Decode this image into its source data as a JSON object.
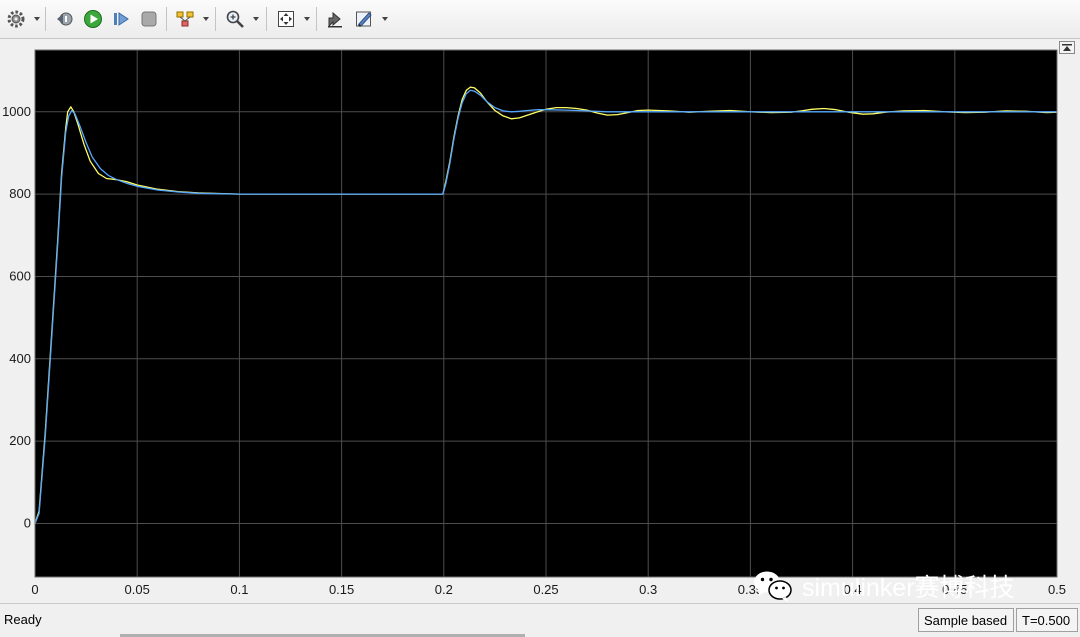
{
  "toolbar": {
    "icons": [
      "gear-icon",
      "step-back-icon",
      "run-icon",
      "step-forward-icon",
      "stop-icon",
      "signal-select-icon",
      "zoom-icon",
      "autoscale-icon",
      "highlight-icon",
      "style-icon"
    ]
  },
  "chart_data": {
    "type": "line",
    "xlim": [
      0,
      0.5
    ],
    "ylim": [
      -130,
      1150
    ],
    "x_ticks": [
      0,
      0.05,
      0.1,
      0.15,
      0.2,
      0.25,
      0.3,
      0.35,
      0.4,
      0.45,
      0.5
    ],
    "x_tick_labels": [
      "0",
      "0.05",
      "0.1",
      "0.15",
      "0.2",
      "0.25",
      "0.3",
      "0.35",
      "0.4",
      "0.45",
      "0.5"
    ],
    "y_ticks": [
      0,
      200,
      400,
      600,
      800,
      1000
    ],
    "y_tick_labels": [
      "0",
      "200",
      "400",
      "600",
      "800",
      "1000"
    ],
    "grid": true,
    "background": "#000000",
    "grid_color": "#4d4d4d",
    "series": [
      {
        "color": "#ffff66",
        "points": [
          [
            0,
            0
          ],
          [
            0.002,
            30
          ],
          [
            0.005,
            220
          ],
          [
            0.008,
            450
          ],
          [
            0.011,
            680
          ],
          [
            0.013,
            850
          ],
          [
            0.015,
            960
          ],
          [
            0.016,
            1000
          ],
          [
            0.0175,
            1012
          ],
          [
            0.019,
            1000
          ],
          [
            0.021,
            970
          ],
          [
            0.024,
            920
          ],
          [
            0.027,
            880
          ],
          [
            0.031,
            850
          ],
          [
            0.035,
            838
          ],
          [
            0.04,
            835
          ],
          [
            0.045,
            830
          ],
          [
            0.05,
            822
          ],
          [
            0.06,
            812
          ],
          [
            0.07,
            806
          ],
          [
            0.08,
            803
          ],
          [
            0.1,
            800
          ],
          [
            0.15,
            800
          ],
          [
            0.1995,
            800
          ],
          [
            0.201,
            830
          ],
          [
            0.203,
            880
          ],
          [
            0.205,
            940
          ],
          [
            0.207,
            990
          ],
          [
            0.209,
            1030
          ],
          [
            0.211,
            1052
          ],
          [
            0.213,
            1060
          ],
          [
            0.215,
            1058
          ],
          [
            0.218,
            1045
          ],
          [
            0.221,
            1025
          ],
          [
            0.225,
            1003
          ],
          [
            0.229,
            990
          ],
          [
            0.233,
            983
          ],
          [
            0.237,
            985
          ],
          [
            0.241,
            992
          ],
          [
            0.246,
            1000
          ],
          [
            0.25,
            1006
          ],
          [
            0.255,
            1010
          ],
          [
            0.26,
            1010
          ],
          [
            0.265,
            1008
          ],
          [
            0.27,
            1004
          ],
          [
            0.275,
            997
          ],
          [
            0.28,
            992
          ],
          [
            0.285,
            993
          ],
          [
            0.29,
            998
          ],
          [
            0.295,
            1003
          ],
          [
            0.3,
            1004
          ],
          [
            0.31,
            1002
          ],
          [
            0.32,
            999
          ],
          [
            0.33,
            1001
          ],
          [
            0.34,
            1003
          ],
          [
            0.35,
            1000
          ],
          [
            0.36,
            998
          ],
          [
            0.37,
            999
          ],
          [
            0.375,
            1002
          ],
          [
            0.38,
            1006
          ],
          [
            0.386,
            1008
          ],
          [
            0.392,
            1005
          ],
          [
            0.398,
            999
          ],
          [
            0.405,
            994
          ],
          [
            0.41,
            995
          ],
          [
            0.416,
            999
          ],
          [
            0.425,
            1002
          ],
          [
            0.435,
            1003
          ],
          [
            0.445,
            1000
          ],
          [
            0.455,
            998
          ],
          [
            0.465,
            999
          ],
          [
            0.475,
            1002
          ],
          [
            0.485,
            1001
          ],
          [
            0.495,
            998
          ],
          [
            0.5,
            999
          ]
        ]
      },
      {
        "color": "#55a6ff",
        "points": [
          [
            0,
            0
          ],
          [
            0.002,
            25
          ],
          [
            0.005,
            210
          ],
          [
            0.008,
            440
          ],
          [
            0.011,
            670
          ],
          [
            0.013,
            840
          ],
          [
            0.015,
            950
          ],
          [
            0.0165,
            990
          ],
          [
            0.018,
            1003
          ],
          [
            0.0195,
            995
          ],
          [
            0.022,
            965
          ],
          [
            0.025,
            925
          ],
          [
            0.028,
            890
          ],
          [
            0.032,
            862
          ],
          [
            0.036,
            845
          ],
          [
            0.04,
            835
          ],
          [
            0.045,
            826
          ],
          [
            0.05,
            819
          ],
          [
            0.06,
            810
          ],
          [
            0.07,
            805
          ],
          [
            0.08,
            802
          ],
          [
            0.1,
            800
          ],
          [
            0.15,
            800
          ],
          [
            0.1995,
            800
          ],
          [
            0.201,
            825
          ],
          [
            0.203,
            875
          ],
          [
            0.205,
            935
          ],
          [
            0.207,
            985
          ],
          [
            0.209,
            1022
          ],
          [
            0.211,
            1044
          ],
          [
            0.213,
            1052
          ],
          [
            0.215,
            1050
          ],
          [
            0.218,
            1040
          ],
          [
            0.221,
            1025
          ],
          [
            0.225,
            1010
          ],
          [
            0.229,
            1002
          ],
          [
            0.233,
            1000
          ],
          [
            0.237,
            1001
          ],
          [
            0.241,
            1003
          ],
          [
            0.246,
            1005
          ],
          [
            0.25,
            1005
          ],
          [
            0.26,
            1004
          ],
          [
            0.27,
            1002
          ],
          [
            0.28,
            1000
          ],
          [
            0.3,
            1000
          ],
          [
            0.35,
            1000
          ],
          [
            0.4,
            1000
          ],
          [
            0.45,
            1000
          ],
          [
            0.5,
            1000
          ]
        ]
      }
    ]
  },
  "status": {
    "ready": "Ready",
    "mode": "Sample based",
    "time": "T=0.500"
  },
  "watermark": {
    "text": "simulinker赛博科技"
  }
}
